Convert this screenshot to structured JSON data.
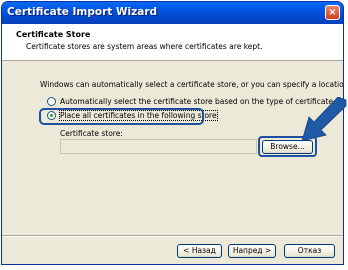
{
  "window": {
    "title": "Certificate Import Wizard",
    "close_symbol": "×"
  },
  "header": {
    "title": "Certificate Store",
    "subtitle": "Certificate stores are system areas where certificates are kept."
  },
  "body": {
    "intro": "Windows can automatically select a certificate store, or you can specify a location for",
    "options": [
      {
        "label": "Automatically select the certificate store based on the type of certificate",
        "selected": false
      },
      {
        "label": "Place all certificates in the following store",
        "selected": true
      }
    ],
    "store_label": "Certificate store:",
    "store_value": "",
    "browse_label": "Browse..."
  },
  "footer": {
    "back_label": "< Назад",
    "next_label": "Напред >",
    "cancel_label": "Отказ"
  },
  "colors": {
    "title_bar": "#0054e3",
    "highlight": "#1f4fa0",
    "arrow": "#1f5aa6"
  },
  "icons": {
    "close": "close-icon",
    "pointer": "arrow-pointer-icon"
  }
}
